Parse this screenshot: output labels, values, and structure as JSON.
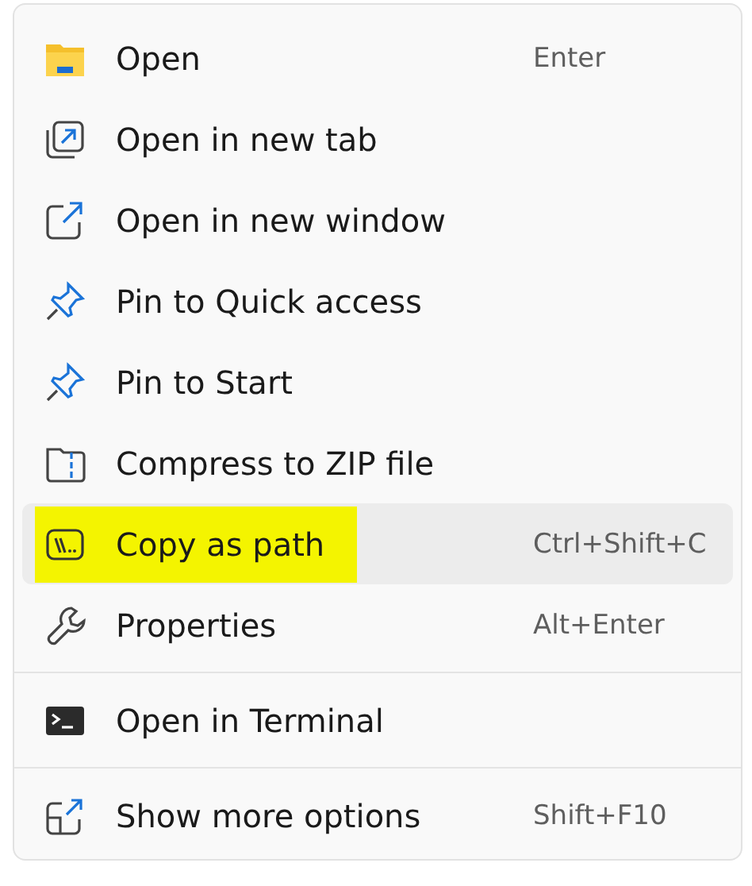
{
  "menu": {
    "groups": [
      {
        "items": [
          {
            "kind": "folder",
            "label": "Open",
            "shortcut": "Enter",
            "selected": false,
            "annotated": false
          },
          {
            "kind": "new-tab",
            "label": "Open in new tab",
            "selected": false,
            "annotated": false
          },
          {
            "kind": "new-window",
            "label": "Open in new window",
            "selected": false,
            "annotated": false
          },
          {
            "kind": "pin",
            "label": "Pin to Quick access",
            "selected": false,
            "annotated": false
          },
          {
            "kind": "pin",
            "label": "Pin to Start",
            "selected": false,
            "annotated": false
          },
          {
            "kind": "zip",
            "label": "Compress to ZIP file",
            "selected": false,
            "annotated": false
          },
          {
            "kind": "path",
            "label": "Copy as path",
            "shortcut": "Ctrl+Shift+C",
            "selected": true,
            "annotated": true
          },
          {
            "kind": "wrench",
            "label": "Properties",
            "shortcut": "Alt+Enter",
            "selected": false,
            "annotated": false
          }
        ]
      },
      {
        "items": [
          {
            "kind": "terminal",
            "label": "Open in Terminal",
            "selected": false,
            "annotated": false
          }
        ]
      },
      {
        "items": [
          {
            "kind": "more",
            "label": "Show more options",
            "shortcut": "Shift+F10",
            "selected": false,
            "annotated": false
          }
        ]
      }
    ]
  }
}
